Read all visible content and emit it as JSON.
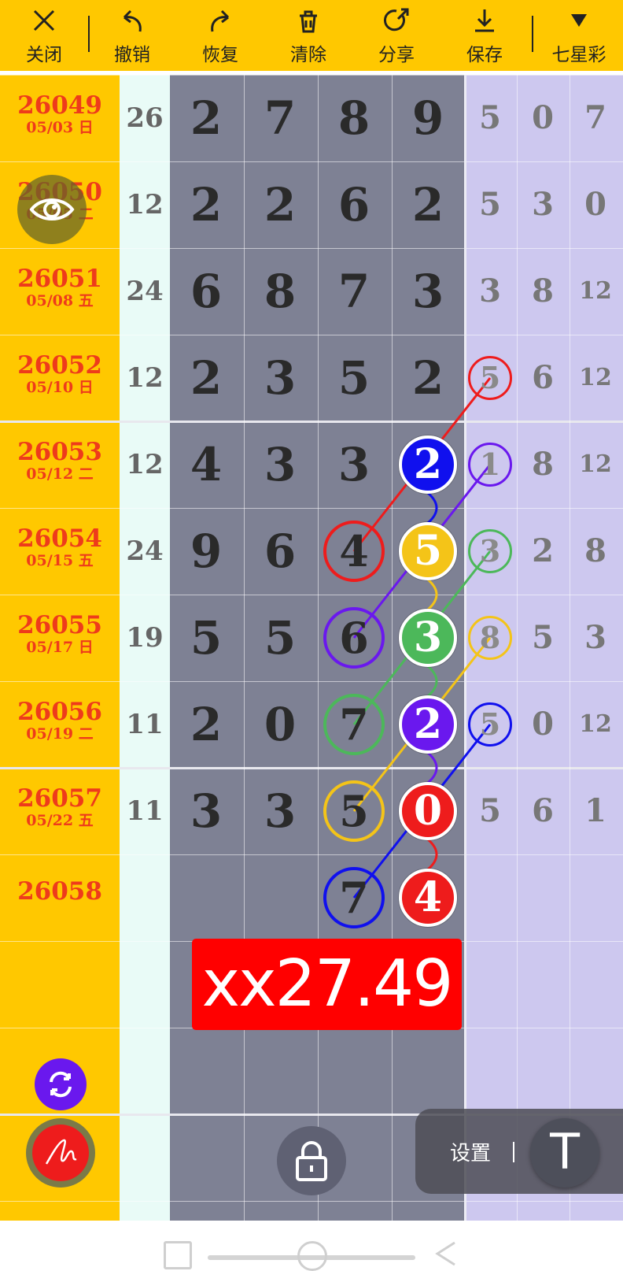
{
  "toolbar": {
    "items": [
      {
        "label": "关闭",
        "icon": "close-icon"
      },
      {
        "label": "撤销",
        "icon": "undo-icon"
      },
      {
        "label": "恢复",
        "icon": "redo-icon"
      },
      {
        "label": "清除",
        "icon": "clear-icon"
      },
      {
        "label": "分享",
        "icon": "share-icon"
      },
      {
        "label": "保存",
        "icon": "download-icon"
      },
      {
        "label": "七星彩",
        "icon": "dropdown-triangle-icon"
      }
    ]
  },
  "rows": [
    {
      "issue": "26049",
      "date": "05/03 日",
      "sum": "26",
      "digits": [
        "2",
        "7",
        "8",
        "9"
      ],
      "tail": [
        "5",
        "0",
        "7"
      ]
    },
    {
      "issue": "26050",
      "date": "05/05 二",
      "sum": "12",
      "digits": [
        "2",
        "2",
        "6",
        "2"
      ],
      "tail": [
        "5",
        "3",
        "0"
      ]
    },
    {
      "issue": "26051",
      "date": "05/08 五",
      "sum": "24",
      "digits": [
        "6",
        "8",
        "7",
        "3"
      ],
      "tail": [
        "3",
        "8",
        "12"
      ]
    },
    {
      "issue": "26052",
      "date": "05/10 日",
      "sum": "12",
      "digits": [
        "2",
        "3",
        "5",
        "2"
      ],
      "tail": [
        "5",
        "6",
        "12"
      ]
    },
    {
      "issue": "26053",
      "date": "05/12 二",
      "sum": "12",
      "digits": [
        "4",
        "3",
        "3",
        "2"
      ],
      "tail": [
        "1",
        "8",
        "12"
      ]
    },
    {
      "issue": "26054",
      "date": "05/15 五",
      "sum": "24",
      "digits": [
        "9",
        "6",
        "4",
        "5"
      ],
      "tail": [
        "3",
        "2",
        "8"
      ]
    },
    {
      "issue": "26055",
      "date": "05/17 日",
      "sum": "19",
      "digits": [
        "5",
        "5",
        "6",
        "3"
      ],
      "tail": [
        "8",
        "5",
        "3"
      ]
    },
    {
      "issue": "26056",
      "date": "05/19 二",
      "sum": "11",
      "digits": [
        "2",
        "0",
        "7",
        "2"
      ],
      "tail": [
        "5",
        "0",
        "12"
      ]
    },
    {
      "issue": "26057",
      "date": "05/22 五",
      "sum": "11",
      "digits": [
        "3",
        "3",
        "5",
        "0"
      ],
      "tail": [
        "5",
        "6",
        "1"
      ]
    },
    {
      "issue": "26058",
      "date": "",
      "sum": "",
      "digits": [
        "",
        "",
        "7",
        "4"
      ],
      "tail": [
        "",
        "",
        ""
      ]
    }
  ],
  "price_badge": "xx27.49",
  "settings_label": "设置",
  "text_tool_glyph": "T",
  "colors": {
    "toolbar": "#ffc800",
    "issue_text": "#ee3b1b",
    "grid_dark": "#7e8194",
    "tail_bg": "#cdc8ef",
    "sum_bg": "#e9fbf7",
    "red": "#ee1c1c",
    "blue": "#1010ee",
    "yellow": "#f4c418",
    "green": "#4cb85a",
    "purple": "#6a18ee"
  }
}
